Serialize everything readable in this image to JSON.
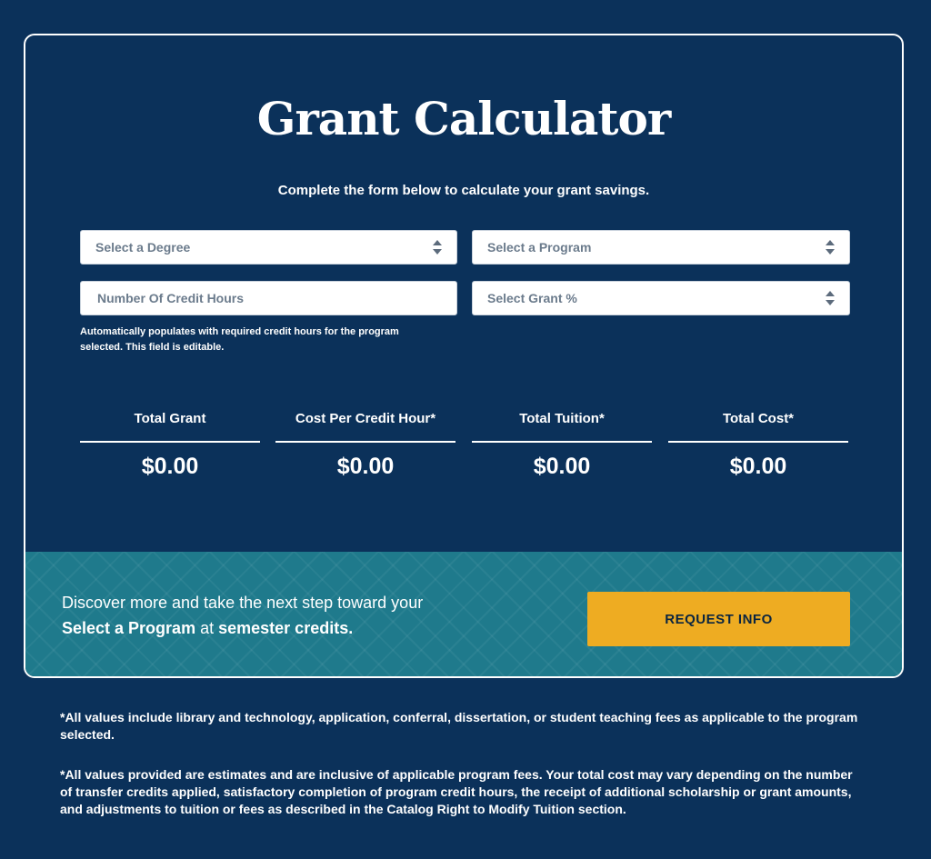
{
  "card": {
    "title": "Grant Calculator",
    "subtitle": "Complete the form below to calculate your grant savings."
  },
  "form": {
    "degree_select": "Select a Degree",
    "program_select": "Select a Program",
    "credit_hours_placeholder": "Number Of Credit Hours",
    "grant_select": "Select Grant %",
    "credit_hours_hint": "Automatically populates with required credit hours for the program selected. This field is editable."
  },
  "results": [
    {
      "label": "Total Grant",
      "value": "$0.00"
    },
    {
      "label": "Cost Per Credit Hour*",
      "value": "$0.00"
    },
    {
      "label": "Total Tuition*",
      "value": "$0.00"
    },
    {
      "label": "Total Cost*",
      "value": "$0.00"
    }
  ],
  "cta": {
    "line1": "Discover more and take the next step toward your",
    "program": "Select a Program",
    "at": "at",
    "credits": "semester credits.",
    "button": "REQUEST INFO"
  },
  "footnotes": [
    "*All values include library and technology, application, conferral, dissertation, or student teaching fees as applicable to the program selected.",
    "*All values provided are estimates and are inclusive of applicable program fees. Your total cost may vary depending on the number of transfer credits applied, satisfactory completion of program credit hours, the receipt of additional scholarship or grant amounts, and adjustments to tuition or fees as described in the Catalog Right to Modify Tuition section."
  ],
  "colors": {
    "background": "#0b315a",
    "cta_band": "#1f7a8c",
    "button": "#eeac22"
  }
}
